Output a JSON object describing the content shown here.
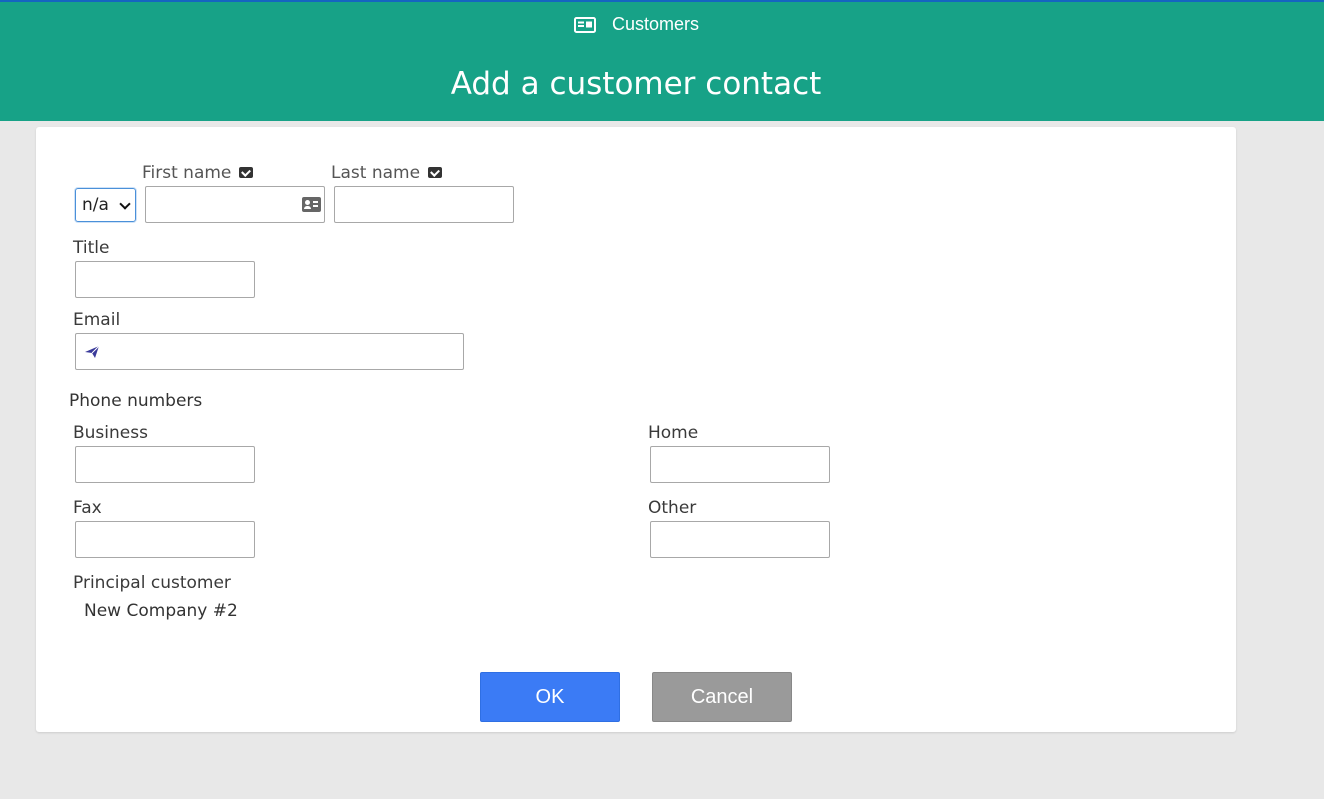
{
  "header": {
    "breadcrumb": "Customers",
    "breadcrumb_icon": "id-card-icon",
    "title": "Add a customer contact",
    "accent_color": "#17a287"
  },
  "form": {
    "salutation": {
      "selected": "n/a"
    },
    "first_name": {
      "label": "First name",
      "value": ""
    },
    "last_name": {
      "label": "Last name",
      "value": ""
    },
    "title": {
      "label": "Title",
      "value": ""
    },
    "email": {
      "label": "Email",
      "value": ""
    },
    "phone_section": "Phone numbers",
    "business": {
      "label": "Business",
      "value": ""
    },
    "home": {
      "label": "Home",
      "value": ""
    },
    "fax": {
      "label": "Fax",
      "value": ""
    },
    "other": {
      "label": "Other",
      "value": ""
    },
    "principal_customer": {
      "label": "Principal customer",
      "value": "New Company #2"
    }
  },
  "actions": {
    "ok_label": "OK",
    "cancel_label": "Cancel",
    "ok_color": "#3b7bf5",
    "cancel_color": "#9a9a9a"
  }
}
